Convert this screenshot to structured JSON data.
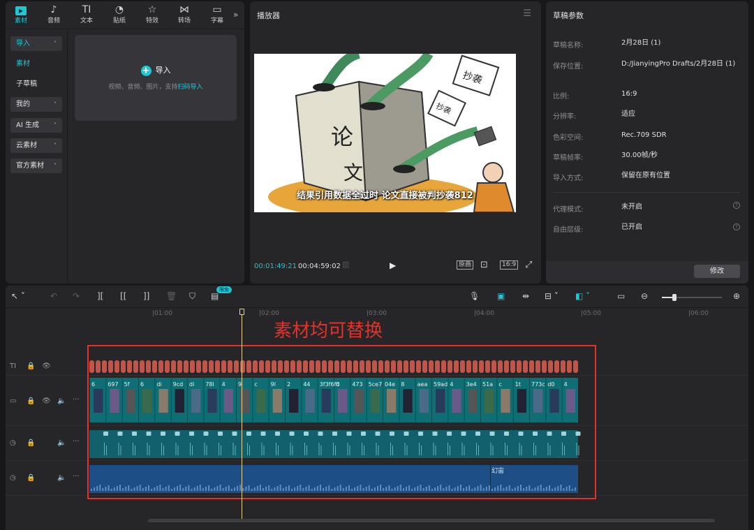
{
  "media_panel": {
    "tabs": [
      {
        "label": "素材",
        "icon": "media-icon",
        "glyph": "▶"
      },
      {
        "label": "音频",
        "icon": "audio-icon",
        "glyph": "♪"
      },
      {
        "label": "文本",
        "icon": "text-icon",
        "glyph": "TI"
      },
      {
        "label": "贴纸",
        "icon": "sticker-icon",
        "glyph": "◔"
      },
      {
        "label": "特效",
        "icon": "effects-icon",
        "glyph": "☆"
      },
      {
        "label": "转场",
        "icon": "transition-icon",
        "glyph": "⋈"
      },
      {
        "label": "字幕",
        "icon": "subtitle-icon",
        "glyph": "▭"
      }
    ],
    "sidebar": [
      {
        "label": "导入",
        "chevron": "˄"
      },
      {
        "label": "素材",
        "chevron": ""
      },
      {
        "label": "子草稿",
        "chevron": ""
      },
      {
        "label": "我的",
        "chevron": "˅"
      },
      {
        "label": "AI 生成",
        "chevron": "˅"
      },
      {
        "label": "云素材",
        "chevron": "˅"
      },
      {
        "label": "官方素材",
        "chevron": "˅"
      }
    ],
    "import_button": "导入",
    "import_hint_prefix": "视频、音频、图片，支持",
    "import_hint_link": "扫码导入"
  },
  "player": {
    "title": "播放器",
    "subtitle": "结果引用数据全过时 论文直接被判抄袭812",
    "book_text_1": "论",
    "book_text_2": "文",
    "sign_1": "抄袭",
    "sign_2": "抄袭",
    "current_time": "00:01:49:21",
    "total_time": "00:04:59:02",
    "original_label": "原画",
    "ratio_label": "16:9"
  },
  "draft_params": {
    "title": "草稿参数",
    "rows": [
      {
        "label": "草稿名称:",
        "value": "2月28日 (1)"
      },
      {
        "label": "保存位置:",
        "value": "D:/JianyingPro Drafts/2月28日 (1)"
      },
      {
        "label": "比例:",
        "value": "16:9"
      },
      {
        "label": "分辨率:",
        "value": "适应"
      },
      {
        "label": "色彩空间:",
        "value": "Rec.709 SDR"
      },
      {
        "label": "草稿帧率:",
        "value": "30.00帧/秒"
      },
      {
        "label": "导入方式:",
        "value": "保留在原有位置"
      }
    ],
    "extra_rows": [
      {
        "label": "代理模式:",
        "value": "未开启"
      },
      {
        "label": "自由层级:",
        "value": "已开启"
      }
    ],
    "modify_button": "修改"
  },
  "timeline": {
    "free_badge": "限免",
    "ruler_marks": [
      "|01:00",
      "|02:00",
      "|03:00",
      "|04:00",
      "|05:00",
      "|06:00"
    ],
    "overlay_text": "素材均可替换",
    "text_track_label": "TI",
    "audio_clip_label": "幻宙",
    "video_clip_labels": [
      "6",
      "697",
      "5f",
      "6",
      "di",
      "9cd",
      "di",
      "78l",
      "4",
      "9",
      "c",
      "9l",
      "2",
      "44",
      "3f3f6fd",
      "0",
      "473",
      "5ce7",
      "04e",
      "8",
      "aea",
      "59ad",
      "4",
      "3e4",
      "51a",
      "c",
      "1t",
      "773c",
      "d0",
      "4"
    ],
    "clip_colors": {
      "text": "#c0564a",
      "video": "#0e6e73",
      "audio": "#12606b",
      "music": "#1d4f86"
    }
  }
}
